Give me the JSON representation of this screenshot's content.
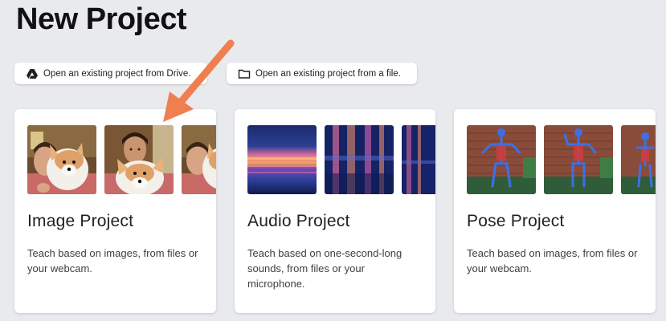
{
  "page": {
    "title": "New Project"
  },
  "open_buttons": {
    "drive": {
      "label": "Open an existing project from Drive.",
      "icon": "google-drive-icon"
    },
    "file": {
      "label": "Open an existing project from a file.",
      "icon": "folder-icon"
    }
  },
  "cards": [
    {
      "title": "Image Project",
      "description": "Teach based on images, from files or your webcam."
    },
    {
      "title": "Audio Project",
      "description": "Teach based on one-second-long sounds, from files or your microphone."
    },
    {
      "title": "Pose Project",
      "description": "Teach based on images, from files or your webcam."
    }
  ],
  "colors": {
    "background": "#e9eaed",
    "card": "#ffffff",
    "annotation_arrow": "#f07f4f",
    "pose_skeleton": "#3d6fe8"
  }
}
